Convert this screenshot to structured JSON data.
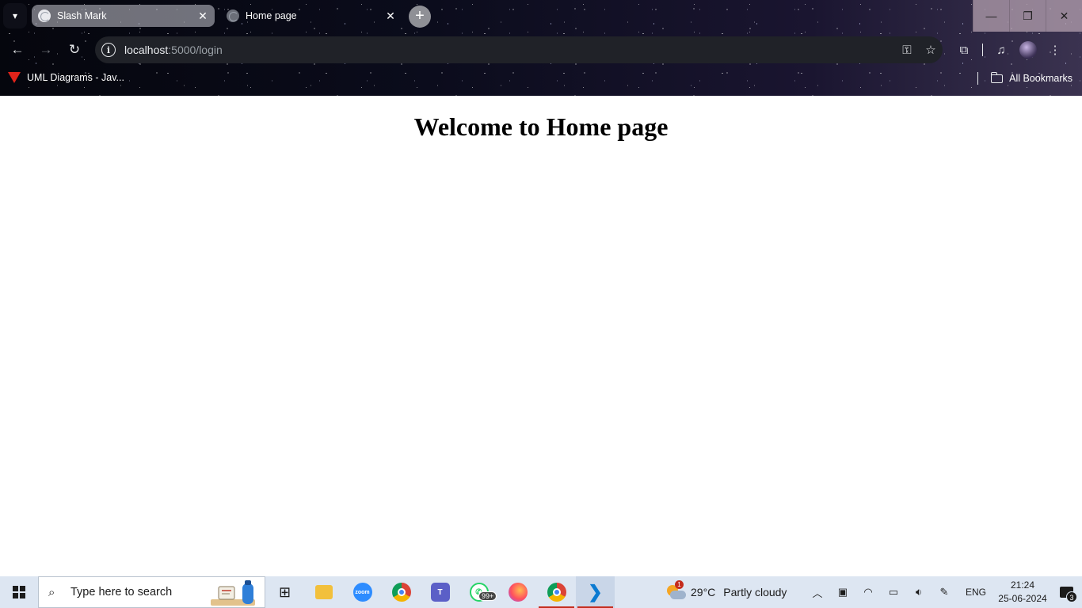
{
  "browser": {
    "tabs": [
      {
        "title": "Slash Mark",
        "active": true
      },
      {
        "title": "Home page",
        "active": false
      }
    ],
    "new_tab_label": "+",
    "address": {
      "host": "localhost",
      "path": ":5000/login"
    },
    "bookmarks": [
      {
        "label": "UML Diagrams - Jav..."
      }
    ],
    "all_bookmarks_label": "All Bookmarks",
    "icons": {
      "tab_search": "chevron-down-icon",
      "back": "arrow-left-icon",
      "forward": "arrow-right-icon",
      "reload": "reload-icon",
      "site_info": "info-icon",
      "password": "key-icon",
      "bookmark": "star-icon",
      "extensions": "puzzle-icon",
      "media": "media-control-icon",
      "menu": "kebab-menu-icon"
    }
  },
  "page": {
    "heading": "Welcome to Home page"
  },
  "taskbar": {
    "search_placeholder": "Type here to search",
    "apps": [
      {
        "name": "task-view",
        "icon": "task-view-icon"
      },
      {
        "name": "file-explorer",
        "icon": "folder-icon"
      },
      {
        "name": "zoom",
        "icon": "zoom-icon",
        "label": "zoom"
      },
      {
        "name": "chrome",
        "icon": "chrome-icon"
      },
      {
        "name": "teams",
        "icon": "teams-icon"
      },
      {
        "name": "whatsapp",
        "icon": "whatsapp-icon",
        "badge": "99+"
      },
      {
        "name": "firefox",
        "icon": "firefox-icon"
      },
      {
        "name": "chrome-profile",
        "icon": "chrome-icon",
        "running": true
      },
      {
        "name": "vscode",
        "icon": "vscode-icon",
        "running": true
      }
    ],
    "weather": {
      "temp": "29°C",
      "condition": "Partly cloudy",
      "alert_count": "1"
    },
    "language": "ENG",
    "time": "21:24",
    "date": "25-06-2024",
    "notification_count": "3"
  },
  "colors": {
    "page_background": "#ffffff",
    "taskbar_background": "#dde6f2",
    "running_indicator": "#c42b1c"
  }
}
